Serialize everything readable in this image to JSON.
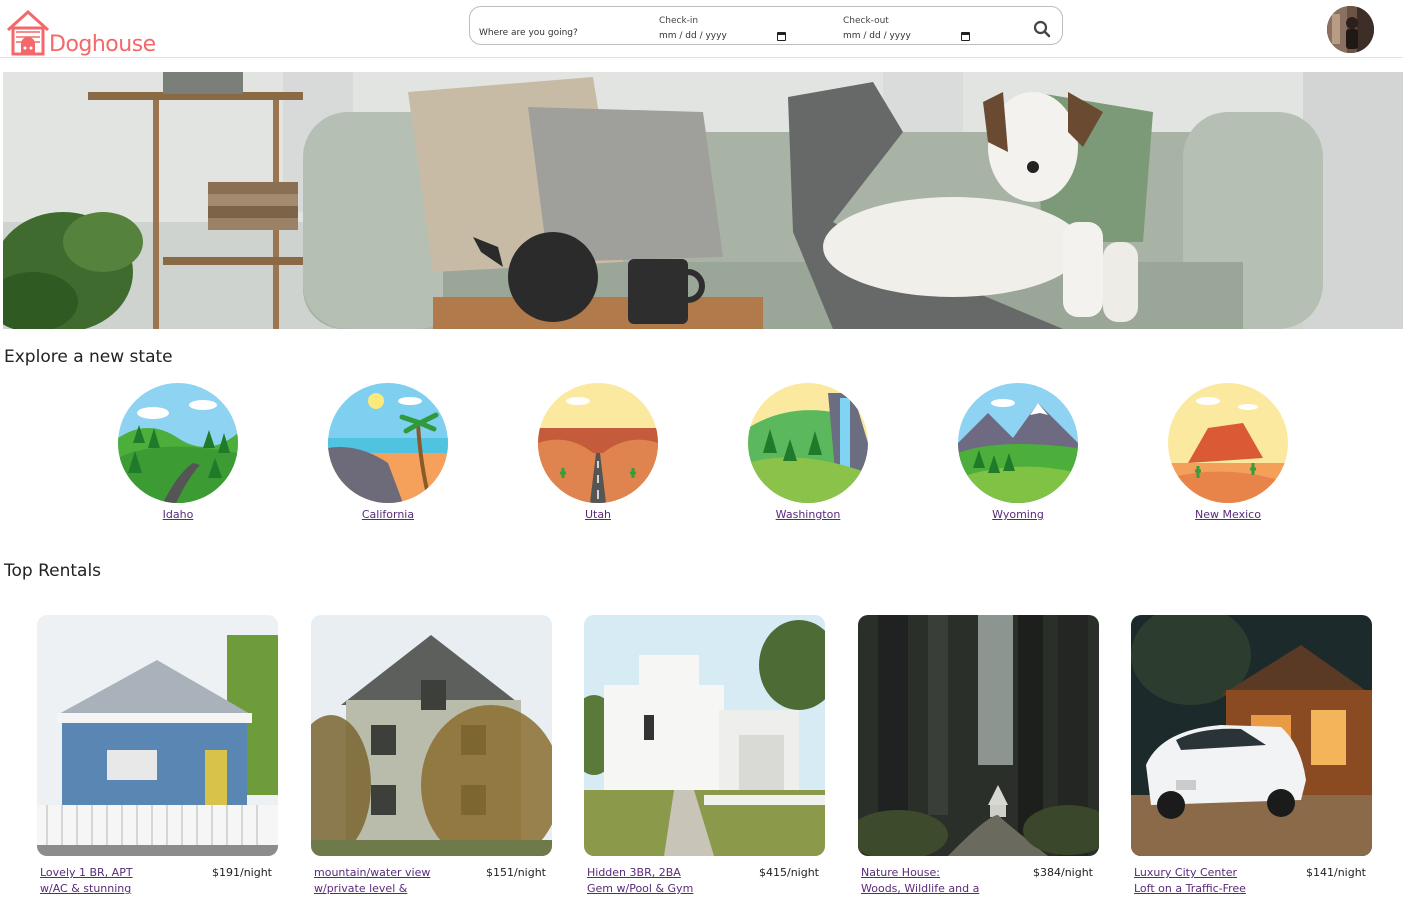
{
  "app": {
    "logo_text": "Doghouse"
  },
  "search": {
    "where_placeholder": "Where are you going?",
    "checkin_label": "Check-in",
    "checkin_value": "mm / dd / yyyy",
    "checkout_label": "Check-out",
    "checkout_value": "mm / dd / yyyy"
  },
  "colors": {
    "brand": "#f4686b",
    "link": "#5a2a7a"
  },
  "sections": {
    "explore_title": "Explore a new state",
    "rentals_title": "Top Rentals"
  },
  "states": [
    {
      "name": "Idaho"
    },
    {
      "name": "California"
    },
    {
      "name": "Utah"
    },
    {
      "name": "Washington"
    },
    {
      "name": "Wyoming"
    },
    {
      "name": "New Mexico"
    }
  ],
  "rentals": [
    {
      "name": "Lovely 1 BR, APT w/AC & stunning",
      "price": "$191/night"
    },
    {
      "name": "mountain/water view w/private level &",
      "price": "$151/night"
    },
    {
      "name": "Hidden 3BR, 2BA Gem w/Pool & Gym",
      "price": "$415/night"
    },
    {
      "name": "Nature House: Woods, Wildlife and a",
      "price": "$384/night"
    },
    {
      "name": "Luxury City Center Loft on a Traffic-Free",
      "price": "$141/night"
    }
  ]
}
